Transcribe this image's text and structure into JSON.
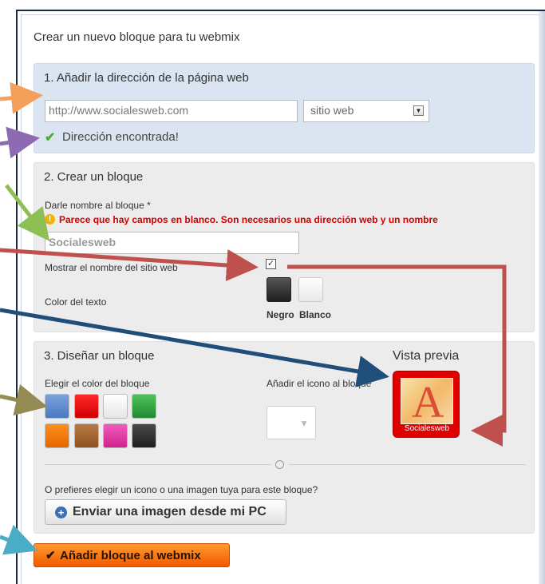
{
  "header": {
    "title": "Crear un nuevo bloque para tu webmix"
  },
  "section1": {
    "title": "1. Añadir la dirección de la página web",
    "url_value": "http://www.socialesweb.com",
    "type_select": "sitio web",
    "found_message": "Dirección encontrada!"
  },
  "section2": {
    "title": "2. Crear un bloque",
    "name_label": "Darle nombre al bloque *",
    "warning": "Parece que hay campos en blanco. Son necesarios una dirección web y un nombre",
    "name_value": "Socialesweb",
    "show_name_label": "Mostrar el nombre del sitio web",
    "text_color_label": "Color del texto",
    "color_options": [
      "Negro",
      "Blanco"
    ]
  },
  "section3": {
    "title": "3. Diseñar un bloque",
    "block_color_label": "Elegir el color del bloque",
    "add_icon_label": "Añadir el icono al bloque",
    "preview_title": "Vista previa",
    "preview_caption": "Socialesweb",
    "or_text": "O prefieres elegir un icono o una imagen tuya para este bloque?",
    "upload_button": "Enviar una imagen desde mi PC",
    "swatch_colors": [
      "#5b8bd0",
      "#e00000",
      "#f2f2f2",
      "#2f9e3e",
      "#f27400",
      "#a6642e",
      "#e23aa3",
      "#333333"
    ],
    "text_colors": [
      "#2a2a2a",
      "#f4f4f4"
    ]
  },
  "footer": {
    "add_button": "Añadir bloque al webmix"
  },
  "colors": {
    "section1_bg": "#dbe4f1",
    "section_bg": "#ececec",
    "warning": "#d20000",
    "preview_tile": "#e10000",
    "add_button": "#f27a14"
  }
}
